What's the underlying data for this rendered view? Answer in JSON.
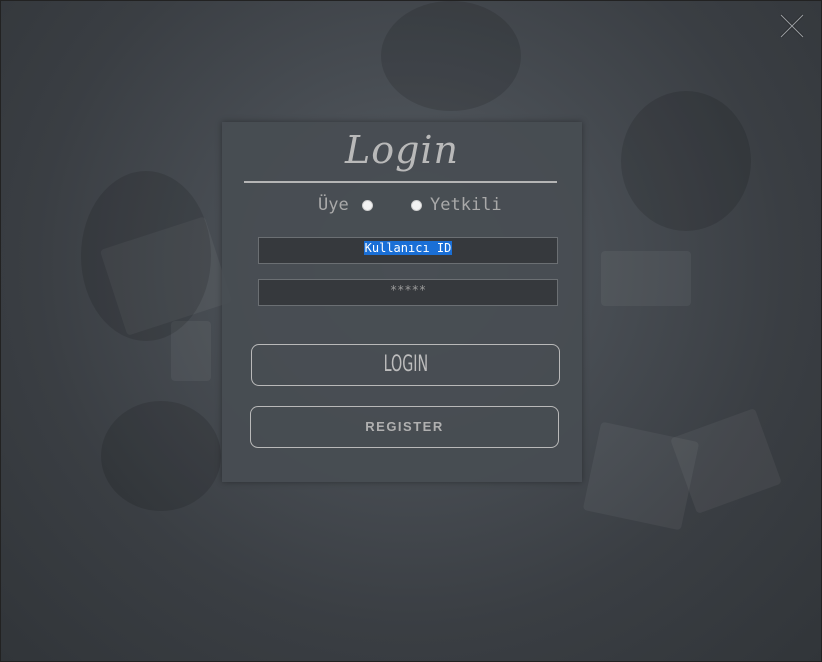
{
  "dialog": {
    "title": "Login",
    "close_icon": "close-x-icon"
  },
  "role_selector": {
    "options": [
      {
        "label": "Üye",
        "selected": false
      },
      {
        "label": "Yetkili",
        "selected": false
      }
    ]
  },
  "fields": {
    "username": {
      "value": "Kullanıcı ID",
      "selected_text": true
    },
    "password": {
      "value": "*****"
    }
  },
  "buttons": {
    "login_label": "LOGIN",
    "register_label": "REGISTER"
  },
  "colors": {
    "panel_background": "#484d52",
    "accent_border": "#b9b9b9",
    "selection_highlight": "#1a6fd6"
  }
}
